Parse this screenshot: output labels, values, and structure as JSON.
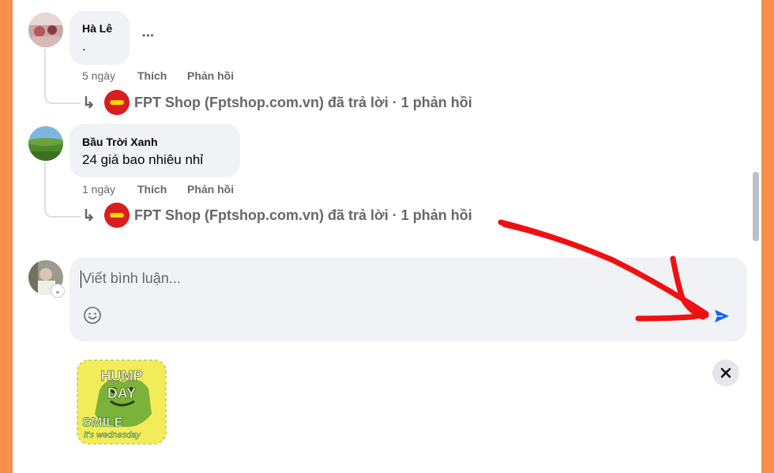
{
  "comments": [
    {
      "author": "Hà Lê",
      "text": ".",
      "time": "5 ngày",
      "like_label": "Thích",
      "reply_label": "Phản hồi",
      "more_label": "•••",
      "reply_summary": "FPT Shop (Fptshop.com.vn) đã trả lời · 1 phản hồi"
    },
    {
      "author": "Bầu Trời Xanh",
      "text": "24 giá bao nhiêu nhỉ",
      "time": "1 ngày",
      "like_label": "Thích",
      "reply_label": "Phản hồi",
      "reply_summary": "FPT Shop (Fptshop.com.vn) đã trả lời · 1 phản hồi"
    }
  ],
  "composer": {
    "placeholder": "Viết bình luận...",
    "emoji_icon": "smiley-icon",
    "send_icon": "send-icon"
  },
  "attachment": {
    "sticker_line1": "HUMP",
    "sticker_line2": "DAY",
    "sticker_line3": "SMILE",
    "sticker_line4": "it's wednesday",
    "close_icon": "close-icon"
  },
  "colors": {
    "background_frame": "#f98f4a",
    "bubble": "#f0f2f5",
    "muted_text": "#65676b",
    "send_blue": "#0866ff",
    "brand_red": "#d81e1e",
    "annotation_red": "#ee1111"
  }
}
